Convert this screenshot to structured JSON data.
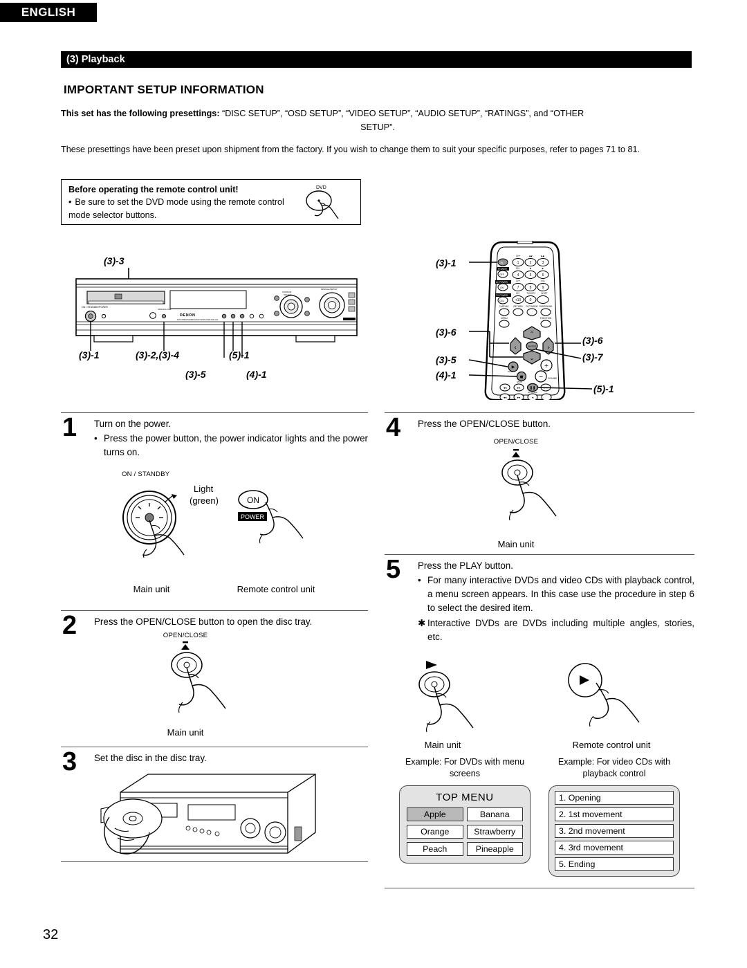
{
  "header": {
    "language": "ENGLISH",
    "section_bar": "(3) Playback",
    "important_title": "IMPORTANT SETUP INFORMATION"
  },
  "intro": {
    "lead_bold": "This set has the following presettings:",
    "lead_rest": " “DISC SETUP”, “OSD SETUP”, “VIDEO SETUP”, “AUDIO SETUP”, “RATINGS”, and  “OTHER",
    "lead_second_line": "SETUP”.",
    "paragraph2": "These presettings have been preset upon shipment from the factory. If you wish to change them to suit your specific purposes, refer to pages 71 to 81."
  },
  "note": {
    "title": "Before operating the remote control unit!",
    "bullet": "•",
    "text": "Be sure to set the DVD mode using the remote control mode selector buttons.",
    "icon_label": "DVD"
  },
  "unit_callouts": {
    "top": "(3)-3",
    "c1": "(3)-1",
    "c2": "(3)-2,(3)-4",
    "c3": "(5)-1",
    "c4": "(3)-5",
    "c5": "(4)-1",
    "brand": "DENON"
  },
  "remote_callouts": {
    "r1": "(3)-1",
    "r2": "(3)-6",
    "r3": "(3)-6",
    "r4": "(3)-5",
    "r5": "(3)-7",
    "r6": "(4)-1",
    "r7": "(5)-1"
  },
  "steps": [
    {
      "num": "1",
      "lead": "Turn on the power.",
      "bullets": [
        {
          "mark": "•",
          "text": "Press the power button, the power indicator lights and the power turns on."
        }
      ],
      "fig": {
        "label_on_standby": "ON / STANDBY",
        "label_light": "Light",
        "label_green": "(green)",
        "remote_on": "ON",
        "remote_power": "POWER",
        "caption_left": "Main unit",
        "caption_right": "Remote control unit"
      }
    },
    {
      "num": "2",
      "lead": "Press the OPEN/CLOSE button to open the disc tray.",
      "bullets": [],
      "fig": {
        "label_open_close": "OPEN/CLOSE",
        "caption": "Main unit"
      }
    },
    {
      "num": "3",
      "lead": "Set the disc in the disc tray.",
      "bullets": []
    },
    {
      "num": "4",
      "lead": "Press the OPEN/CLOSE button.",
      "bullets": [],
      "fig": {
        "label_open_close": "OPEN/CLOSE",
        "caption": "Main unit"
      }
    },
    {
      "num": "5",
      "lead": "Press the PLAY button.",
      "bullets": [
        {
          "mark": "•",
          "text": "For many interactive DVDs and video CDs with playback control, a menu screen appears. In this case use the procedure in step 6 to select the desired item."
        },
        {
          "mark": "✱",
          "text": "Interactive DVDs are DVDs including multiple angles, stories, etc."
        }
      ],
      "fig": {
        "caption_left": "Main unit",
        "caption_right": "Remote control unit"
      }
    }
  ],
  "examples": {
    "left": {
      "caption": "Example: For DVDs with menu screens",
      "title": "TOP MENU",
      "cells": [
        {
          "label": "Apple",
          "selected": true
        },
        {
          "label": "Banana",
          "selected": false
        },
        {
          "label": "Orange",
          "selected": false
        },
        {
          "label": "Strawberry",
          "selected": false
        },
        {
          "label": "Peach",
          "selected": false
        },
        {
          "label": "Pineapple",
          "selected": false
        }
      ]
    },
    "right": {
      "caption": "Example: For video CDs with playback control",
      "items": [
        "1. Opening",
        "2. 1st movement",
        "3. 2nd movement",
        "4. 3rd movement",
        "5. Ending"
      ]
    }
  },
  "page_number": "32",
  "colors": {
    "bar": "#000000",
    "screen_bg": "#e3e3e3",
    "selected_cell": "#b9b9b9",
    "rule": "#555555"
  }
}
